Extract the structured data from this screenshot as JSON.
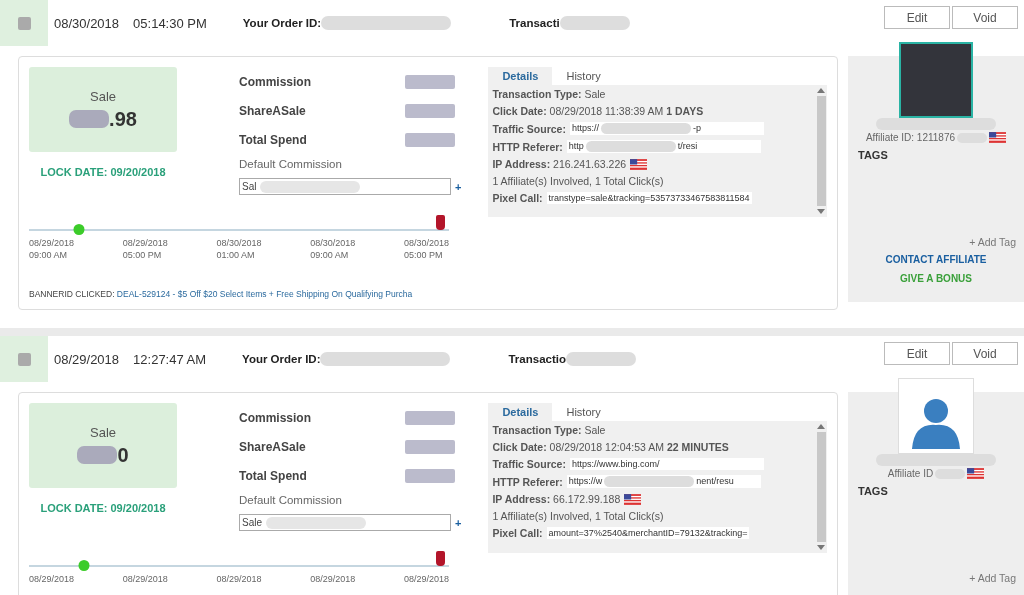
{
  "transactions": [
    {
      "checked": false,
      "date": "08/30/2018",
      "time": "05:14:30 PM",
      "order_id_label": "Your Order ID:",
      "transaction_label": "Transacti",
      "buttons": [
        "Edit",
        "Void"
      ],
      "sale": {
        "label": "Sale",
        "amount": ".98"
      },
      "lock_date": "LOCK DATE: 09/20/2018",
      "fields": [
        "Commission",
        "ShareASale",
        "Total Spend"
      ],
      "default_commission_label": "Default Commission",
      "commission_value": "Sal",
      "add_symbol": "+",
      "timeline": {
        "level": 0.12,
        "ticks": [
          {
            "date": "08/29/2018",
            "time": "09:00 AM"
          },
          {
            "date": "08/29/2018",
            "time": "05:00 PM"
          },
          {
            "date": "08/30/2018",
            "time": "01:00 AM"
          },
          {
            "date": "08/30/2018",
            "time": "09:00 AM"
          },
          {
            "date": "08/30/2018",
            "time": "05:00 PM"
          }
        ]
      },
      "banner": {
        "label": "BANNERID CLICKED:",
        "link": "DEAL-529124 - $5 Off $20 Select Items + Free Shipping On Qualifying Purcha"
      },
      "tabs": [
        {
          "label": "Details",
          "selected": true
        },
        {
          "label": "History",
          "selected": false
        }
      ],
      "details": [
        {
          "kind": "text",
          "label": "Transaction Type:",
          "value": "Sale"
        },
        {
          "kind": "text",
          "label": "Click Date:",
          "value": "08/29/2018 11:38:39 AM",
          "emphasis": "1 DAYS"
        },
        {
          "kind": "field",
          "label": "Traffic Source:",
          "value": "https://",
          "tail": "-p"
        },
        {
          "kind": "field",
          "label": "HTTP Referer:",
          "value": "http",
          "tail": "t/resi"
        },
        {
          "kind": "ip",
          "label": "IP Address:",
          "value": "216.241.63.226"
        },
        {
          "kind": "note",
          "value": "1 Affiliate(s) Involved, 1 Total Click(s)"
        },
        {
          "kind": "field",
          "label": "Pixel Call:",
          "value": "transtype=sale&tracking=53573733467583811584"
        }
      ],
      "affiliate": {
        "kind": "logo",
        "affiliate_id": "Affiliate ID: 1211876",
        "tags_label": "TAGS",
        "add_tag": "+ Add Tag",
        "contact": "CONTACT AFFILIATE",
        "bonus": "GIVE A BONUS"
      }
    },
    {
      "checked": false,
      "date": "08/29/2018",
      "time": "12:27:47 AM",
      "order_id_label": "Your Order ID:",
      "transaction_label": "Transactio",
      "buttons": [
        "Edit",
        "Void"
      ],
      "sale": {
        "label": "Sale",
        "amount": "0"
      },
      "lock_date": "LOCK DATE: 09/20/2018",
      "fields": [
        "Commission",
        "ShareASale",
        "Total Spend"
      ],
      "default_commission_label": "Default Commission",
      "commission_value": "Sale",
      "add_symbol": "+",
      "timeline": {
        "level": 0.13,
        "ticks": [
          {
            "date": "08/29/2018"
          },
          {
            "date": "08/29/2018"
          },
          {
            "date": "08/29/2018"
          },
          {
            "date": "08/29/2018"
          },
          {
            "date": "08/29/2018"
          }
        ]
      },
      "tabs": [
        {
          "label": "Details",
          "selected": true
        },
        {
          "label": "History",
          "selected": false
        }
      ],
      "details": [
        {
          "kind": "text",
          "label": "Transaction Type:",
          "value": "Sale"
        },
        {
          "kind": "text",
          "label": "Click Date:",
          "value": "08/29/2018 12:04:53 AM",
          "emphasis": "22 MINUTES"
        },
        {
          "kind": "field",
          "label": "Traffic Source:",
          "value": "https://www.bing.com/"
        },
        {
          "kind": "field",
          "label": "HTTP Referer:",
          "value": "https://w",
          "tail": "nent/resu"
        },
        {
          "kind": "ip",
          "label": "IP Address:",
          "value": "66.172.99.188"
        },
        {
          "kind": "note",
          "value": "1 Affiliate(s) Involved, 1 Total Click(s)"
        },
        {
          "kind": "field",
          "label": "Pixel Call:",
          "value": "amount=37%2540&merchantID=79132&tracking="
        }
      ],
      "affiliate": {
        "kind": "silhouette",
        "affiliate_id": "Affiliate ID",
        "tags_label": "TAGS",
        "add_tag": "+ Add Tag"
      }
    }
  ]
}
